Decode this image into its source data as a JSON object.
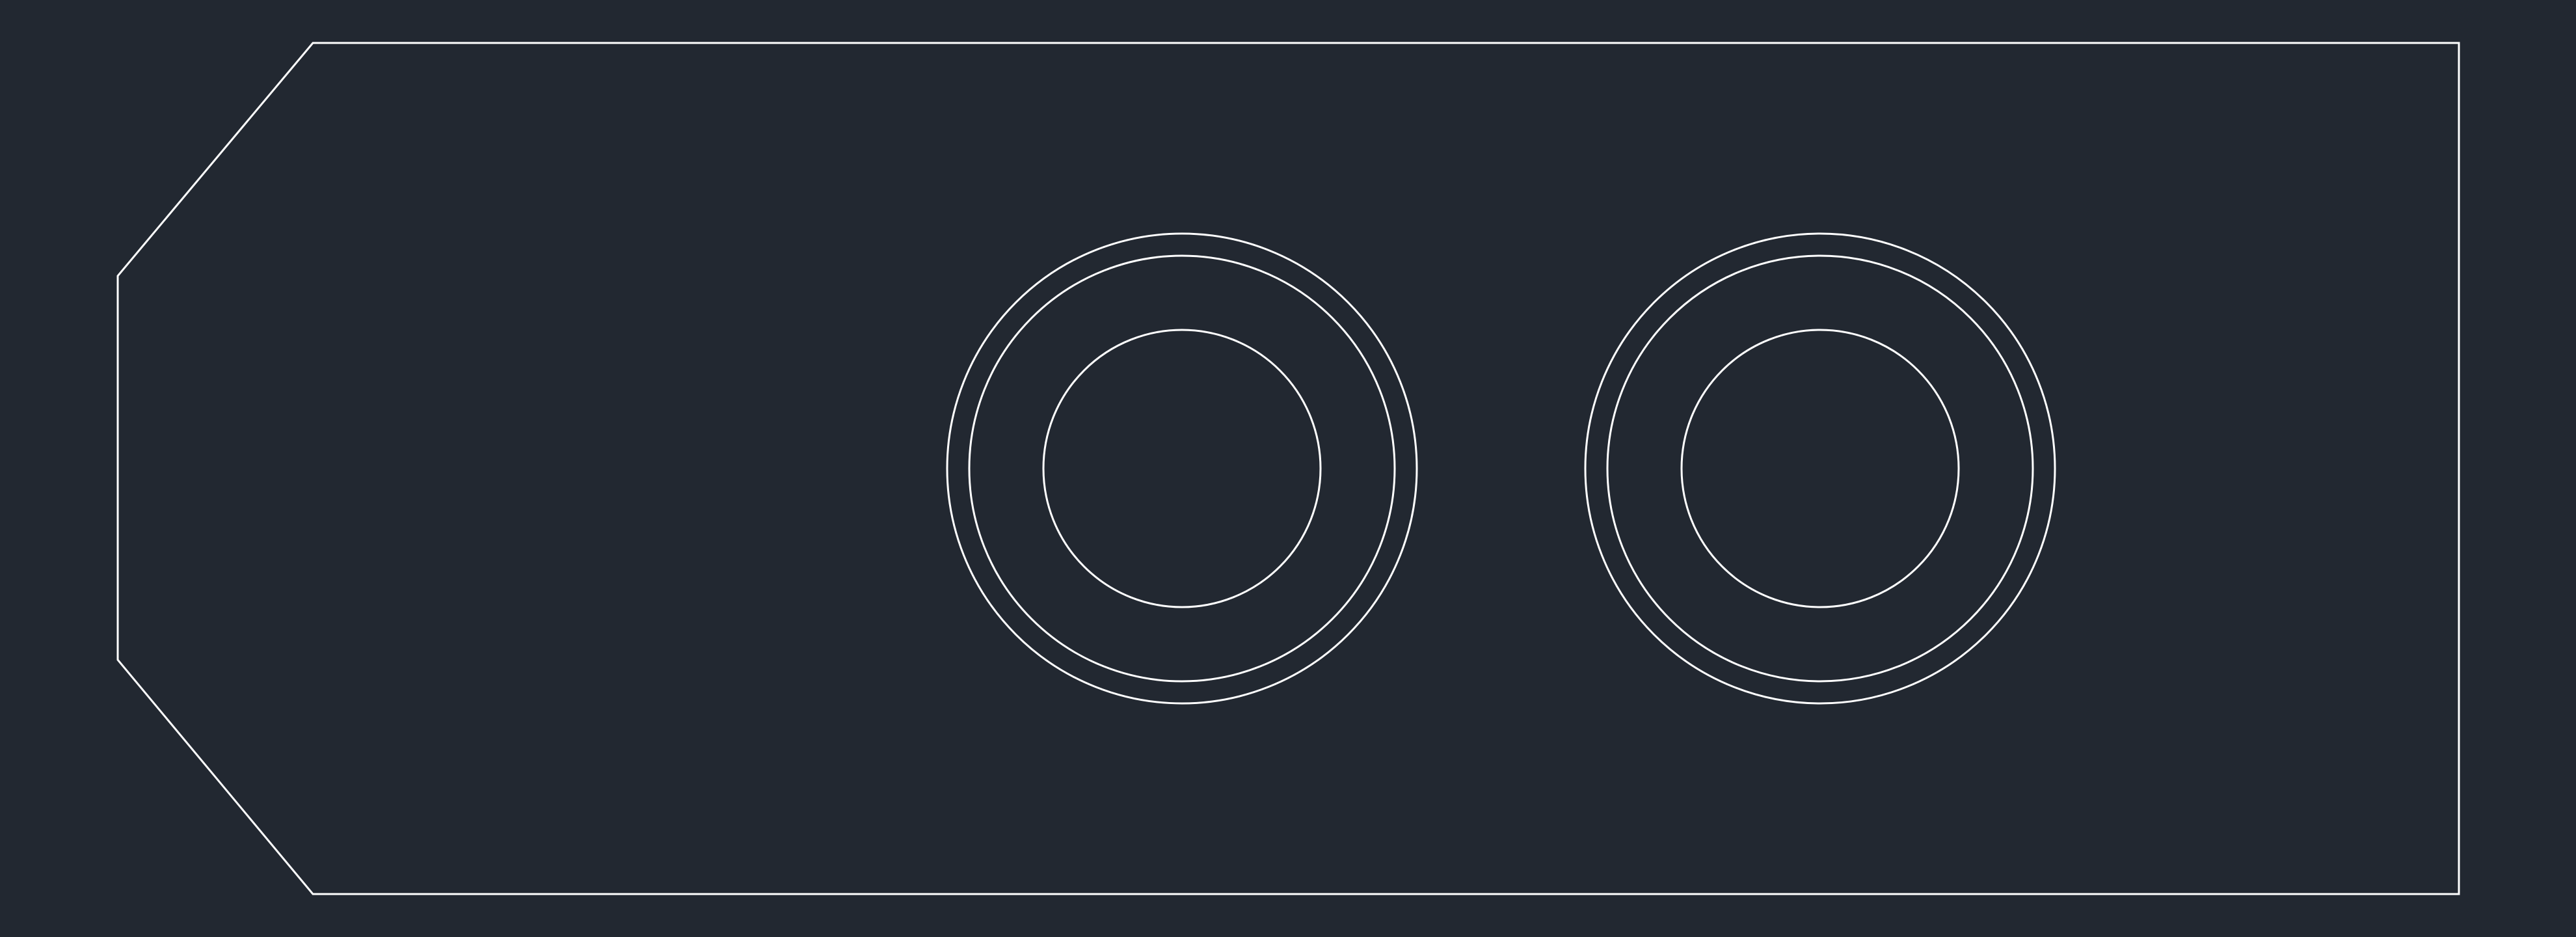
{
  "canvas": {
    "background_color": "#222831",
    "line_color": "#ffffff"
  },
  "drawing": {
    "outline": {
      "shape": "plate-with-chamfered-left-end"
    },
    "holes": [
      {
        "name": "left-hole",
        "ring_count": 3
      },
      {
        "name": "right-hole",
        "ring_count": 3
      }
    ]
  }
}
